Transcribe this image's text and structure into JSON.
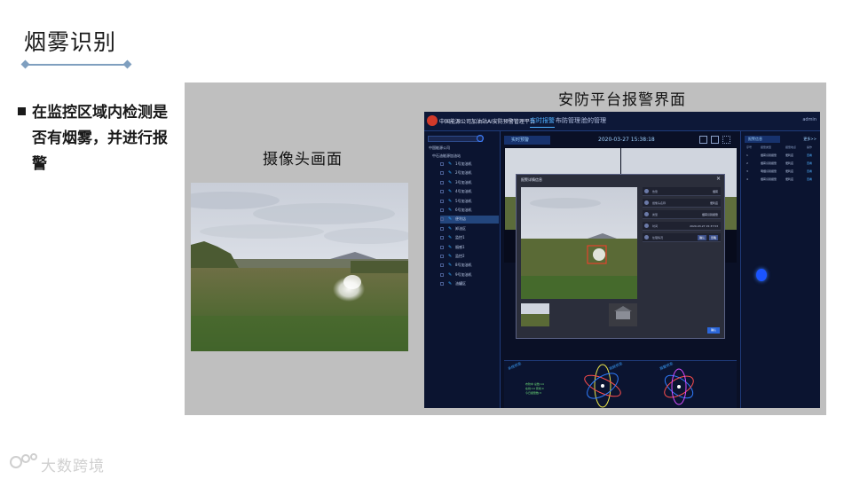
{
  "slide": {
    "title": "烟雾识别",
    "bullet": "在监控区域内检测是否有烟雾，并进行报警"
  },
  "labels": {
    "camera": "摄像头画面",
    "platform": "安防平台报警界面"
  },
  "platform": {
    "app_title": "中国能源公司加油站AI安防预警管理平台",
    "tabs": [
      "实时报警",
      "布防管理",
      "脸的管理"
    ],
    "user_info": "admin",
    "sidebar": {
      "tree_root": "中国能源公司",
      "tree_sub": "中石油能源加油站",
      "items": [
        "1号加油机",
        "2号加油机",
        "3号加油机",
        "4号加油机",
        "5号加油机",
        "6号加油机",
        "便利店",
        "卸油区",
        "监控1",
        "烟感1",
        "监控2",
        "8号加油机",
        "9号加油机",
        "油罐区"
      ],
      "selected_index": 6
    },
    "main": {
      "tab_label": "实时预警",
      "datetime": "2020-03-27 15:38:18"
    },
    "dialog": {
      "title": "报警详情信息",
      "close": "×",
      "info_rows": [
        {
          "key": "告警",
          "value": "烟雾"
        },
        {
          "key": "摄像头名称",
          "value": "便利店"
        },
        {
          "key": "类型",
          "value": "烟雾识别报警"
        },
        {
          "key": "时间",
          "value": "2020-03-27 15:37:53"
        },
        {
          "key": "处理情况",
          "value": ""
        }
      ],
      "handle_buttons": [
        "确认",
        "忽略"
      ],
      "confirm": "确认"
    },
    "bottom": {
      "labels": [
        "系统状态",
        "视频状态",
        "报警状态"
      ],
      "green_text": [
        "布防中 总数:14",
        "在线:14 离线:0",
        "今日报警数:3"
      ]
    },
    "right_panel": {
      "title": "报警信息",
      "more": "更多>>",
      "columns": [
        "序号",
        "报警类型",
        "报警地点",
        "操作"
      ],
      "rows": [
        [
          "1",
          "烟雾识别报警",
          "便利店",
          "查看"
        ],
        [
          "2",
          "烟雾识别报警",
          "便利店",
          "查看"
        ],
        [
          "3",
          "明烟识别报警",
          "便利店",
          "查看"
        ],
        [
          "4",
          "烟雾识别报警",
          "便利店",
          "查看"
        ]
      ]
    }
  },
  "watermark": "大数跨境",
  "colors": {
    "title_rule": "#7f9fbf",
    "panel_gray": "#bfbfbf",
    "platform_bg": "#0a1026",
    "accent_blue": "#4fb0ff",
    "alarm_box": "#ff3b2b"
  }
}
